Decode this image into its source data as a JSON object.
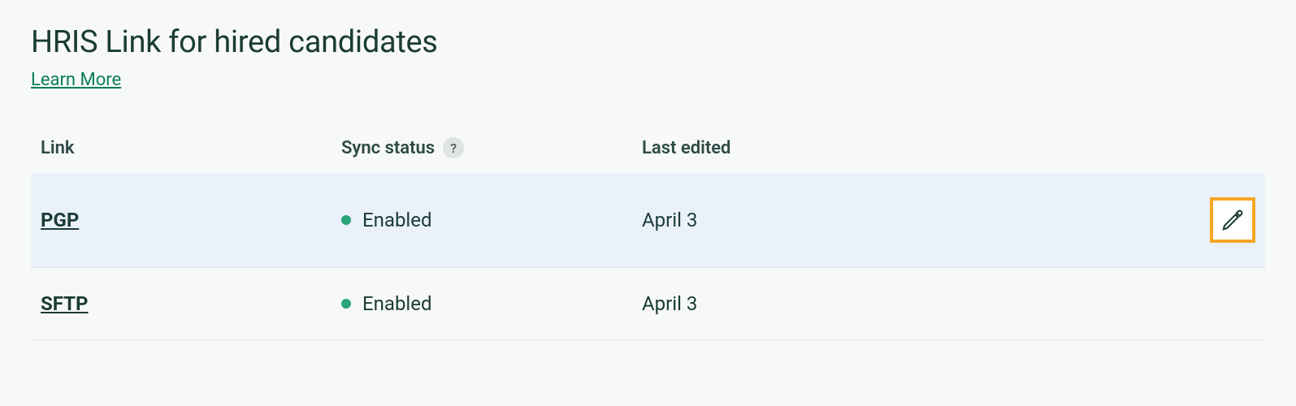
{
  "header": {
    "title": "HRIS Link for hired candidates",
    "learn_more": "Learn More"
  },
  "table": {
    "columns": {
      "link": "Link",
      "sync_status": "Sync status",
      "last_edited": "Last edited"
    },
    "help_glyph": "?",
    "rows": [
      {
        "name": "PGP",
        "status": "Enabled",
        "status_color": "#2aa57a",
        "last_edited": "April 3",
        "highlighted": true,
        "show_edit": true
      },
      {
        "name": "SFTP",
        "status": "Enabled",
        "status_color": "#2aa57a",
        "last_edited": "April 3",
        "highlighted": false,
        "show_edit": false
      }
    ]
  },
  "colors": {
    "accent_green": "#0a7d5a",
    "highlight_bg": "#eaf1fb",
    "edit_border": "#f5a623"
  }
}
